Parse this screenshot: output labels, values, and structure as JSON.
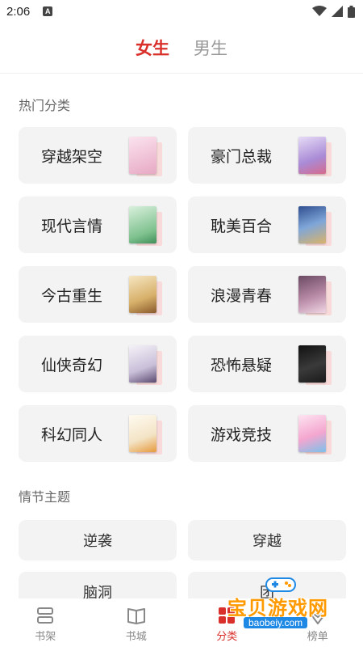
{
  "status_bar": {
    "time": "2:06",
    "notification_icon": "A"
  },
  "gender_tabs": [
    {
      "label": "女生",
      "active": true
    },
    {
      "label": "男生",
      "active": false
    }
  ],
  "hot_section": {
    "title": "热门分类",
    "categories": [
      {
        "label": "穿越架空",
        "cover_color": "#f2c9da"
      },
      {
        "label": "豪门总裁",
        "cover_color": "#cfb8e8"
      },
      {
        "label": "现代言情",
        "cover_color": "#a8d8b0"
      },
      {
        "label": "耽美百合",
        "cover_color": "#7fa6d9"
      },
      {
        "label": "今古重生",
        "cover_color": "#e8cf8f"
      },
      {
        "label": "浪漫青春",
        "cover_color": "#b88aa6"
      },
      {
        "label": "仙侠奇幻",
        "cover_color": "#e9e4ef"
      },
      {
        "label": "恐怖悬疑",
        "cover_color": "#2b2b2b"
      },
      {
        "label": "科幻同人",
        "cover_color": "#f6efe2"
      },
      {
        "label": "游戏竞技",
        "cover_color": "#f4c4de"
      }
    ]
  },
  "plot_section": {
    "title": "情节主题",
    "items": [
      "逆袭",
      "穿越",
      "脑洞",
      "团"
    ]
  },
  "bottom_nav": [
    {
      "label": "书架",
      "icon": "bookshelf-icon",
      "active": false
    },
    {
      "label": "书城",
      "icon": "book-open-icon",
      "active": false
    },
    {
      "label": "分类",
      "icon": "category-icon",
      "active": true
    },
    {
      "label": "榜单",
      "icon": "ranking-icon",
      "active": false
    }
  ],
  "watermark": {
    "title": "宝贝游戏网",
    "url": "baobeiy.com"
  },
  "colors": {
    "accent": "#d9302b",
    "card_bg": "#f3f3f3",
    "muted": "#999999"
  }
}
